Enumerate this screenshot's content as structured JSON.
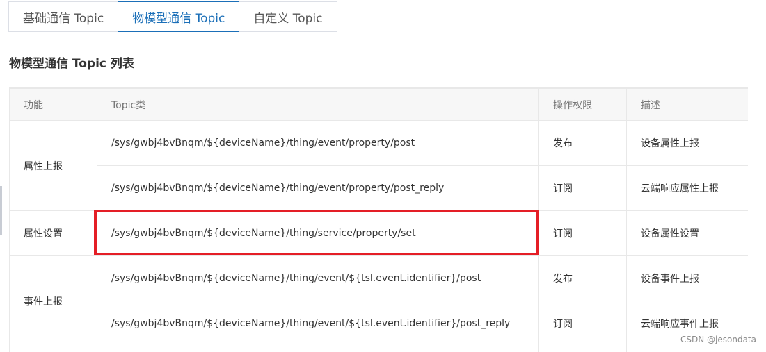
{
  "tabs": [
    {
      "label": "基础通信 Topic",
      "active": false
    },
    {
      "label": "物模型通信 Topic",
      "active": true
    },
    {
      "label": "自定义 Topic",
      "active": false
    }
  ],
  "section_title": "物模型通信 Topic 列表",
  "table": {
    "headers": [
      "功能",
      "Topic类",
      "操作权限",
      "描述"
    ],
    "groups": [
      {
        "function": "属性上报",
        "rows": [
          {
            "topic": "/sys/gwbj4bvBnqm/${deviceName}/thing/event/property/post",
            "permission": "发布",
            "description": "设备属性上报"
          },
          {
            "topic": "/sys/gwbj4bvBnqm/${deviceName}/thing/event/property/post_reply",
            "permission": "订阅",
            "description": "云端响应属性上报"
          }
        ]
      },
      {
        "function": "属性设置",
        "rows": [
          {
            "topic": "/sys/gwbj4bvBnqm/${deviceName}/thing/service/property/set",
            "permission": "订阅",
            "description": "设备属性设置"
          }
        ]
      },
      {
        "function": "事件上报",
        "rows": [
          {
            "topic": "/sys/gwbj4bvBnqm/${deviceName}/thing/event/${tsl.event.identifier}/post",
            "permission": "发布",
            "description": "设备事件上报"
          },
          {
            "topic": "/sys/gwbj4bvBnqm/${deviceName}/thing/event/${tsl.event.identifier}/post_reply",
            "permission": "订阅",
            "description": "云端响应事件上报"
          }
        ]
      }
    ]
  },
  "highlight_color": "#e41e26",
  "accent_color": "#1b6fb8",
  "watermark": "CSDN @jesondata"
}
